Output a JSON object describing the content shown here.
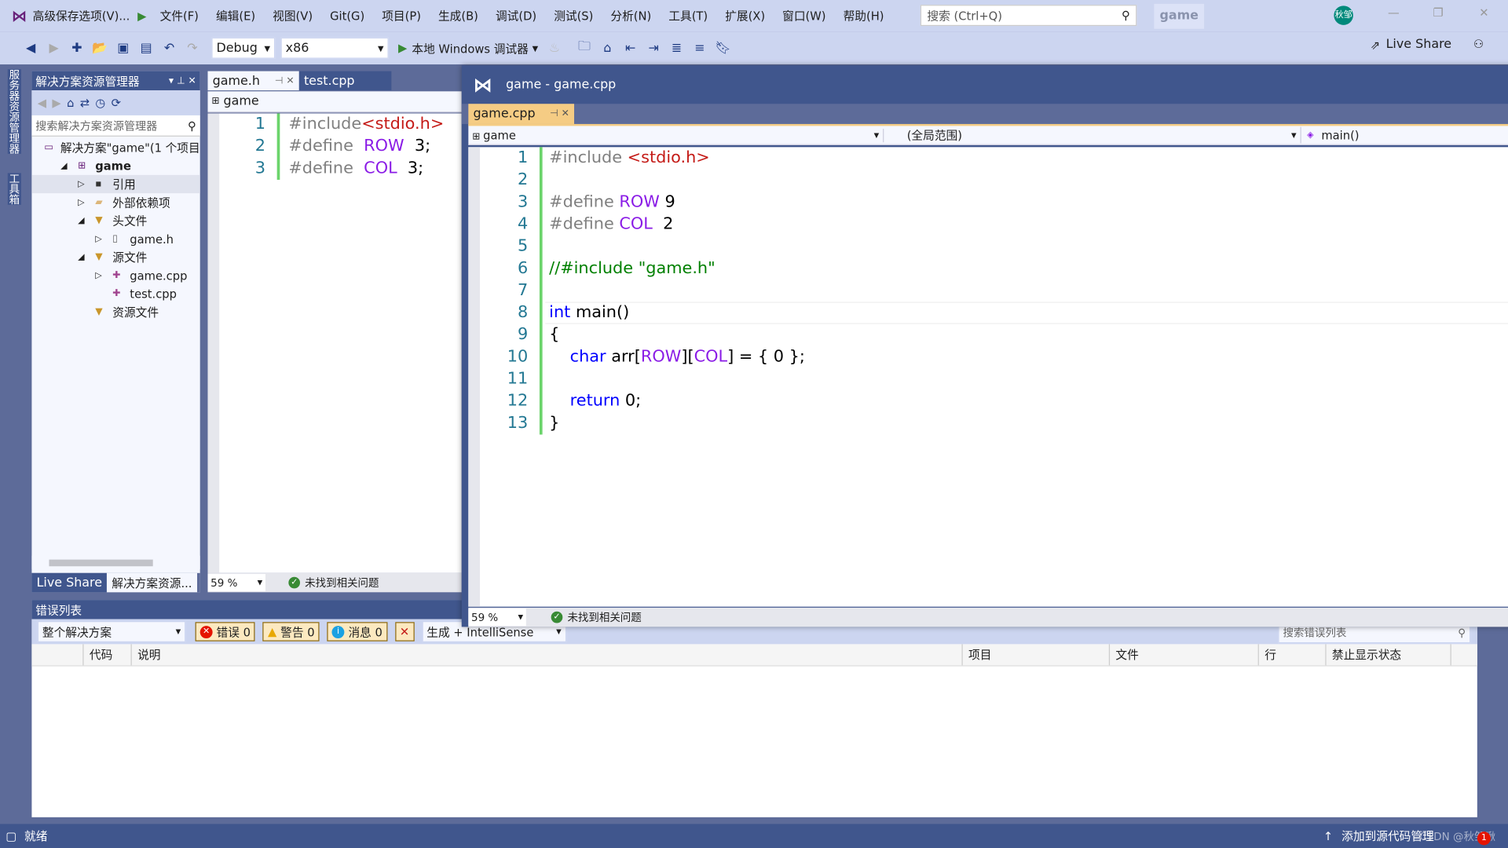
{
  "app": {
    "title_menu": "高级保存选项(V)...",
    "menus": [
      "文件(F)",
      "编辑(E)",
      "视图(V)",
      "Git(G)",
      "项目(P)",
      "生成(B)",
      "调试(D)",
      "测试(S)",
      "分析(N)",
      "工具(T)",
      "扩展(X)",
      "窗口(W)",
      "帮助(H)"
    ],
    "search_placeholder": "搜索 (Ctrl+Q)",
    "solution_badge": "game",
    "avatar": "秋邹",
    "avatar_color": "#00897B"
  },
  "toolbar": {
    "config": "Debug",
    "platform": "x86",
    "run_label": "本地 Windows 调试器",
    "live_share": "Live Share"
  },
  "side_tabs": [
    "服务器资源管理器",
    "工具箱"
  ],
  "solution_explorer": {
    "title": "解决方案资源管理器",
    "search_placeholder": "搜索解决方案资源管理器",
    "items": [
      {
        "label": "解决方案\"game\"(1 个项目",
        "icon": "solution-icon"
      },
      {
        "label": "game",
        "icon": "project-icon"
      },
      {
        "label": "引用",
        "icon": "references-icon"
      },
      {
        "label": "外部依赖项",
        "icon": "external-deps-icon"
      },
      {
        "label": "头文件",
        "icon": "filter-folder-icon"
      },
      {
        "label": "game.h",
        "icon": "header-file-icon"
      },
      {
        "label": "源文件",
        "icon": "filter-folder-icon"
      },
      {
        "label": "game.cpp",
        "icon": "cpp-file-icon"
      },
      {
        "label": "test.cpp",
        "icon": "cpp-file-icon"
      },
      {
        "label": "资源文件",
        "icon": "filter-folder-icon"
      }
    ],
    "bottom_tabs": [
      "Live Share",
      "解决方案资源..."
    ]
  },
  "left_editor": {
    "tabs": [
      "game.h",
      "test.cpp"
    ],
    "scope": "game",
    "zoom": "59 %",
    "status": "未找到相关问题",
    "lines": [
      [
        {
          "t": "#include",
          "c": "pp"
        },
        {
          "t": "<stdio.h>",
          "c": "str"
        }
      ],
      [
        {
          "t": "#define  ",
          "c": "pp"
        },
        {
          "t": "ROW",
          "c": "macro"
        },
        {
          "t": "  3;",
          "c": "plain"
        }
      ],
      [
        {
          "t": "#define  ",
          "c": "pp"
        },
        {
          "t": "COL",
          "c": "macro"
        },
        {
          "t": "  3;",
          "c": "plain"
        }
      ]
    ]
  },
  "float_window": {
    "title": "game - game.cpp",
    "tab": "game.cpp",
    "scope_project": "game",
    "scope_global": "(全局范围)",
    "scope_member": "main()",
    "zoom": "59 %",
    "status": "未找到相关问题",
    "lines": [
      [
        {
          "t": "#include ",
          "c": "pp"
        },
        {
          "t": "<stdio.h>",
          "c": "str"
        }
      ],
      [],
      [
        {
          "t": "#define ",
          "c": "pp"
        },
        {
          "t": "ROW",
          "c": "macro"
        },
        {
          "t": " 9",
          "c": "plain"
        }
      ],
      [
        {
          "t": "#define ",
          "c": "pp"
        },
        {
          "t": "COL",
          "c": "macro"
        },
        {
          "t": "  2",
          "c": "plain"
        }
      ],
      [],
      [
        {
          "t": "//#include \"game.h\"",
          "c": "cm"
        }
      ],
      [],
      [
        {
          "t": "int",
          "c": "kw"
        },
        {
          "t": " main()",
          "c": "plain"
        }
      ],
      [
        {
          "t": "{",
          "c": "plain"
        }
      ],
      [
        {
          "t": "    ",
          "c": "plain"
        },
        {
          "t": "char",
          "c": "kw"
        },
        {
          "t": " arr[",
          "c": "plain"
        },
        {
          "t": "ROW",
          "c": "macro"
        },
        {
          "t": "][",
          "c": "plain"
        },
        {
          "t": "COL",
          "c": "macro"
        },
        {
          "t": "] = { 0 };",
          "c": "plain"
        }
      ],
      [],
      [
        {
          "t": "    ",
          "c": "plain"
        },
        {
          "t": "return",
          "c": "kw"
        },
        {
          "t": " 0;",
          "c": "plain"
        }
      ],
      [
        {
          "t": "}",
          "c": "plain"
        }
      ]
    ]
  },
  "error_list": {
    "title": "错误列表",
    "scope": "整个解决方案",
    "errors": "错误 0",
    "warnings": "警告 0",
    "messages": "消息 0",
    "source": "生成 + IntelliSense",
    "search_placeholder": "搜索错误列表",
    "columns": [
      "",
      "代码",
      "说明",
      "项目",
      "文件",
      "行",
      "禁止显示状态"
    ]
  },
  "statusbar": {
    "ready": "就绪",
    "source_control": "添加到源代码管理",
    "watermark": "CSDN @秋邹啾",
    "notification_count": "1"
  }
}
